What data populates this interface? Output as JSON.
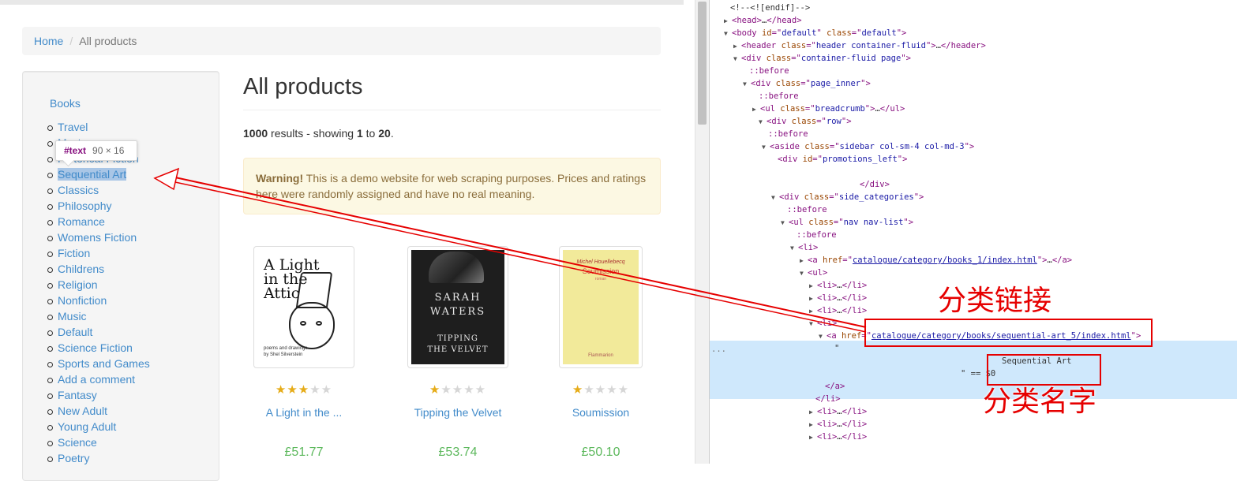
{
  "breadcrumb": {
    "home": "Home",
    "separator": "/",
    "current": "All products"
  },
  "sidebar": {
    "top_link": "Books",
    "categories": [
      "Travel",
      "Mystery",
      "Historical Fiction",
      "Sequential Art",
      "Classics",
      "Philosophy",
      "Romance",
      "Womens Fiction",
      "Fiction",
      "Childrens",
      "Religion",
      "Nonfiction",
      "Music",
      "Default",
      "Science Fiction",
      "Sports and Games",
      "Add a comment",
      "Fantasy",
      "New Adult",
      "Young Adult",
      "Science",
      "Poetry"
    ],
    "highlighted": "Sequential Art"
  },
  "tooltip": {
    "tag": "#text",
    "dims": "90 × 16"
  },
  "main": {
    "heading": "All products",
    "results": {
      "count": "1000",
      "mid": " results - showing ",
      "from": "1",
      "to_word": " to ",
      "to": "20",
      "end": "."
    },
    "warning": {
      "strong": "Warning!",
      "text": " This is a demo website for web scraping purposes. Prices and ratings here were randomly assigned and have no real meaning."
    }
  },
  "products": [
    {
      "title": "A Light in the ...",
      "price": "£51.77",
      "rating": 3,
      "cover": {
        "title": "A Light in the Attic",
        "byline": "poems and drawings by Shel Silverstein"
      }
    },
    {
      "title": "Tipping the Velvet",
      "price": "£53.74",
      "rating": 1,
      "cover": {
        "author": "SARAH WATERS",
        "title": "TIPPING THE VELVET"
      }
    },
    {
      "title": "Soumission",
      "price": "£50.10",
      "rating": 1,
      "cover": {
        "author": "Michel Houellebecq",
        "title": "Soumission",
        "subtitle": "roman",
        "publisher": "Flammarion"
      }
    }
  ],
  "devtools": {
    "lines": [
      {
        "t": "<!--<![endif]-->"
      },
      {
        "a": "▶",
        "o": "<head>",
        "m": "…",
        "c": "</head>"
      },
      {
        "a": "▼",
        "o": "<body",
        "attrs": [
          [
            "id",
            "default"
          ],
          [
            "class",
            "default"
          ]
        ],
        "e": ">"
      },
      {
        "a": "▶",
        "o": "<header",
        "attrs": [
          [
            "class",
            "header container-fluid"
          ]
        ],
        "e": ">",
        "m": "…",
        "c": "</header>"
      },
      {
        "a": "▼",
        "o": "<div",
        "attrs": [
          [
            "class",
            "container-fluid page"
          ]
        ],
        "e": ">"
      },
      {
        "p": "::before"
      },
      {
        "a": "▼",
        "o": "<div",
        "attrs": [
          [
            "class",
            "page_inner"
          ]
        ],
        "e": ">"
      },
      {
        "p": "::before"
      },
      {
        "a": "▶",
        "o": "<ul",
        "attrs": [
          [
            "class",
            "breadcrumb"
          ]
        ],
        "e": ">",
        "m": "…",
        "c": "</ul>"
      },
      {
        "a": "▼",
        "o": "<div",
        "attrs": [
          [
            "class",
            "row"
          ]
        ],
        "e": ">"
      },
      {
        "p": "::before"
      },
      {
        "a": "▼",
        "o": "<aside",
        "attrs": [
          [
            "class",
            "sidebar col-sm-4 col-md-3"
          ]
        ],
        "e": ">"
      },
      {
        "o": "<div",
        "attrs": [
          [
            "id",
            "promotions_left"
          ]
        ],
        "e": ">"
      },
      {
        "t": ""
      },
      {
        "c": "</div>"
      },
      {
        "a": "▼",
        "o": "<div",
        "attrs": [
          [
            "class",
            "side_categories"
          ]
        ],
        "e": ">"
      },
      {
        "p": "::before"
      },
      {
        "a": "▼",
        "o": "<ul",
        "attrs": [
          [
            "class",
            "nav nav-list"
          ]
        ],
        "e": ">"
      },
      {
        "p": "::before"
      },
      {
        "a": "▼",
        "o": "<li>"
      },
      {
        "a": "▶",
        "o": "<a",
        "attrs": [
          [
            "href",
            "catalogue/category/books_1/index.html"
          ]
        ],
        "e": ">",
        "m": "…",
        "c": "</a>"
      },
      {
        "a": "▼",
        "o": "<ul>"
      },
      {
        "a": "▶",
        "o": "<li>",
        "m": "…",
        "c": "</li>"
      },
      {
        "a": "▶",
        "o": "<li>",
        "m": "…",
        "c": "</li>"
      },
      {
        "a": "▶",
        "o": "<li>",
        "m": "…",
        "c": "</li>"
      },
      {
        "a": "▼",
        "o": "<li>"
      },
      {
        "a": "▼",
        "o": "<a",
        "attrs": [
          [
            "href",
            "catalogue/category/books/sequential-art_5/index.html"
          ]
        ],
        "e": ">"
      },
      {
        "t": "\""
      },
      {
        "t": "Sequential Art"
      },
      {
        "t": "\" == $0"
      },
      {
        "c": "</a>"
      },
      {
        "c": "</li>"
      },
      {
        "a": "▶",
        "o": "<li>",
        "m": "…",
        "c": "</li>"
      },
      {
        "a": "▶",
        "o": "<li>",
        "m": "…",
        "c": "</li>"
      },
      {
        "a": "▶",
        "o": "<li>",
        "m": "…",
        "c": "</li>"
      }
    ],
    "dots": "..."
  },
  "annotations": {
    "link_label": "分类链接",
    "name_label": "分类名字",
    "color": "#e60000"
  }
}
